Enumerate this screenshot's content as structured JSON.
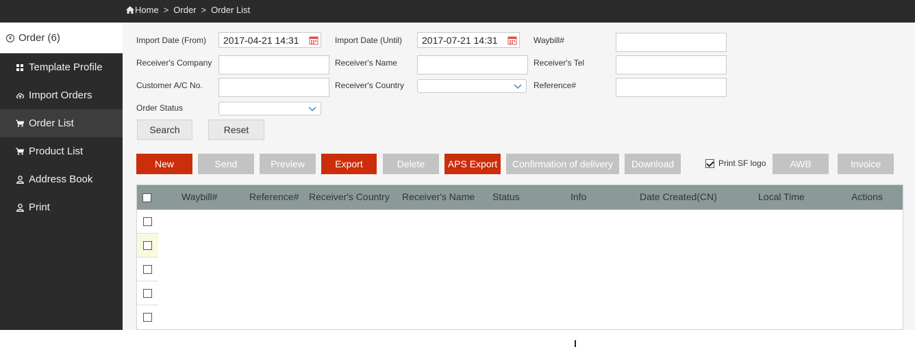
{
  "breadcrumb": {
    "home": "Home",
    "order": "Order",
    "current": "Order List"
  },
  "sidebar": {
    "header": "Order (6)",
    "items": [
      {
        "label": "Template Profile"
      },
      {
        "label": "Import Orders"
      },
      {
        "label": "Order List"
      },
      {
        "label": "Product List"
      },
      {
        "label": "Address Book"
      },
      {
        "label": "Print"
      }
    ]
  },
  "filters": {
    "import_from_label": "Import Date (From)",
    "import_from_value": "2017-04-21 14:31",
    "import_until_label": "Import Date (Until)",
    "import_until_value": "2017-07-21 14:31",
    "waybill_label": "Waybill#",
    "waybill_value": "",
    "receiver_company_label": "Receiver's Company",
    "receiver_company_value": "",
    "receiver_name_label": "Receiver's Name",
    "receiver_name_value": "",
    "receiver_tel_label": "Receiver's Tel",
    "receiver_tel_value": "",
    "customer_ac_label": "Customer A/C No.",
    "customer_ac_value": "",
    "receiver_country_label": "Receiver's Country",
    "receiver_country_value": "",
    "reference_label": "Reference#",
    "reference_value": "",
    "order_status_label": "Order Status",
    "order_status_value": "",
    "search_label": "Search",
    "reset_label": "Reset"
  },
  "toolbar": {
    "new": "New",
    "send": "Send",
    "preview": "Preview",
    "export": "Export",
    "delete": "Delete",
    "aps_export": "APS Export",
    "confirmation": "Confirmation of delivery",
    "download": "Download",
    "print_sf_logo": "Print SF logo",
    "print_sf_logo_checked": true,
    "awb": "AWB",
    "invoice": "Invoice"
  },
  "table": {
    "columns": [
      "Waybill#",
      "Reference#",
      "Receiver's Country",
      "Receiver's Name",
      "Status",
      "Info",
      "Date Created(CN)",
      "Local Time",
      "Actions"
    ],
    "row_count": 5
  },
  "colors": {
    "accent_red": "#cc2d0b",
    "button_gray": "#c3c3c3",
    "header_gray": "#8b9a99",
    "sidebar_dark": "#2b2b2b"
  }
}
